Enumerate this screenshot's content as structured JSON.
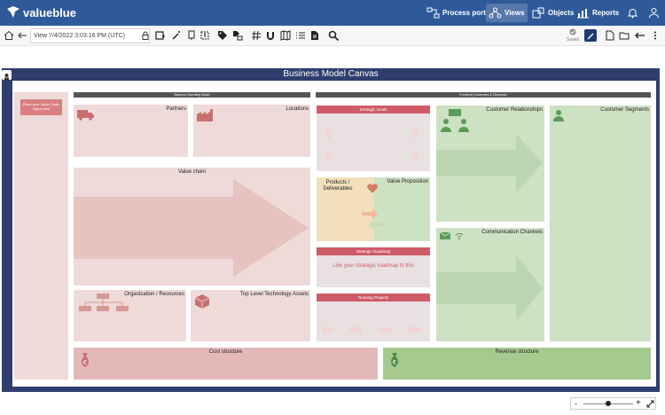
{
  "app": {
    "brand": "valueblue"
  },
  "nav": {
    "process_portal": "Process portal",
    "views": "Views",
    "objects": "Objects",
    "reports": "Reports"
  },
  "toolbar": {
    "view_label": "View 7/4/2022 3:03:16 PM (UTC)",
    "saved_label": "Saved"
  },
  "canvas": {
    "title": "Business Model Canvas",
    "left_hint": "Place your Value Chain object here",
    "backend_header": "Backend Operating Model",
    "frontend_header": "Frontend (Customers & Channels)",
    "partners": "Partners",
    "locations": "Locations",
    "value_chain": "Value chain",
    "org_resources": "Organization / Resources",
    "tech_assets": "Top Level Technology Assets",
    "strategic_goals": "Strategic Goals",
    "products": "Products / Deliverables",
    "value_proposition": "Value Proposition",
    "strategic_roadmap": "Strategic Roadmap",
    "roadmap_link": "Link your strategic roadmap to this",
    "running_projects": "Running Projects",
    "customer_relationships": "Customer Relationships",
    "customer_segments": "Customer Segments",
    "communication_channels": "Communication Channels",
    "cost_structure": "Cost structure",
    "revenue_structure": "Revenue structure"
  },
  "zoom": {
    "minus": "-",
    "plus": "+"
  },
  "colors": {
    "topbar": "#2f5a9a",
    "frame": "#2f3e6e",
    "accent_red": "#cf5b68"
  }
}
